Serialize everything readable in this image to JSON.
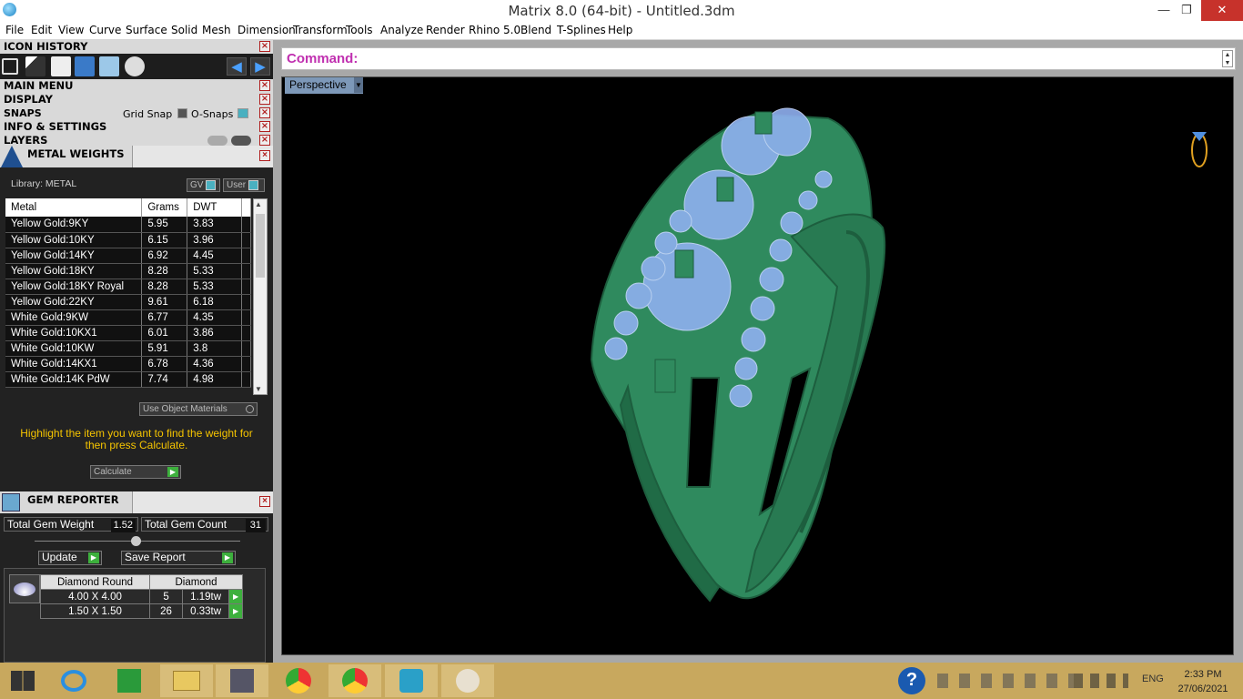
{
  "window": {
    "title": "Matrix 8.0 (64-bit) - Untitled.3dm",
    "min": "—",
    "max": "❐",
    "close": "✕"
  },
  "menu": [
    "File",
    "Edit",
    "View",
    "Curve",
    "Surface",
    "Solid",
    "Mesh",
    "Dimension",
    "Transform",
    "Tools",
    "Analyze",
    "Render",
    "Rhino 5.0",
    "Blend",
    "T-Splines",
    "Help"
  ],
  "panels": {
    "icon_history": "ICON HISTORY",
    "main_menu": "MAIN MENU",
    "display": "DISPLAY",
    "snaps": "SNAPS",
    "grid_snap": "Grid Snap",
    "osnaps": "O-Snaps",
    "info": "INFO & SETTINGS",
    "layers": "LAYERS"
  },
  "metal_weights": {
    "title": "METAL WEIGHTS",
    "library": "Library: METAL",
    "gv": "GV",
    "user": "User",
    "columns": [
      "Metal",
      "Grams",
      "DWT"
    ],
    "rows": [
      [
        "Yellow Gold:9KY",
        "5.95",
        "3.83"
      ],
      [
        "Yellow Gold:10KY",
        "6.15",
        "3.96"
      ],
      [
        "Yellow Gold:14KY",
        "6.92",
        "4.45"
      ],
      [
        "Yellow Gold:18KY",
        "8.28",
        "5.33"
      ],
      [
        "Yellow Gold:18KY Royal",
        "8.28",
        "5.33"
      ],
      [
        "Yellow Gold:22KY",
        "9.61",
        "6.18"
      ],
      [
        "White Gold:9KW",
        "6.77",
        "4.35"
      ],
      [
        "White Gold:10KX1",
        "6.01",
        "3.86"
      ],
      [
        "White Gold:10KW",
        "5.91",
        "3.8"
      ],
      [
        "White Gold:14KX1",
        "6.78",
        "4.36"
      ],
      [
        "White Gold:14K PdW",
        "7.74",
        "4.98"
      ]
    ],
    "use_object_materials": "Use Object Materials",
    "hint": "Highlight the item you want to find the weight for then press Calculate.",
    "calculate": "Calculate"
  },
  "gem_reporter": {
    "title": "GEM REPORTER",
    "total_weight_label": "Total Gem Weight",
    "total_weight": "1.52",
    "total_count_label": "Total Gem Count",
    "total_count": "31",
    "update": "Update",
    "save_report": "Save Report",
    "header_cut": "Diamond Round",
    "header_type": "Diamond",
    "rows": [
      [
        "4.00 X 4.00",
        "5",
        "1.19tw"
      ],
      [
        "1.50 X 1.50",
        "26",
        "0.33tw"
      ]
    ]
  },
  "command_label": "Command:",
  "viewport_label": "Perspective",
  "taskbar": {
    "lang": "ENG",
    "time": "2:33 PM",
    "date": "27/06/2021"
  },
  "colors": {
    "metal": "#2f8a5e",
    "gem": "#8fb0f0",
    "menu_accent": "#c030b0"
  }
}
